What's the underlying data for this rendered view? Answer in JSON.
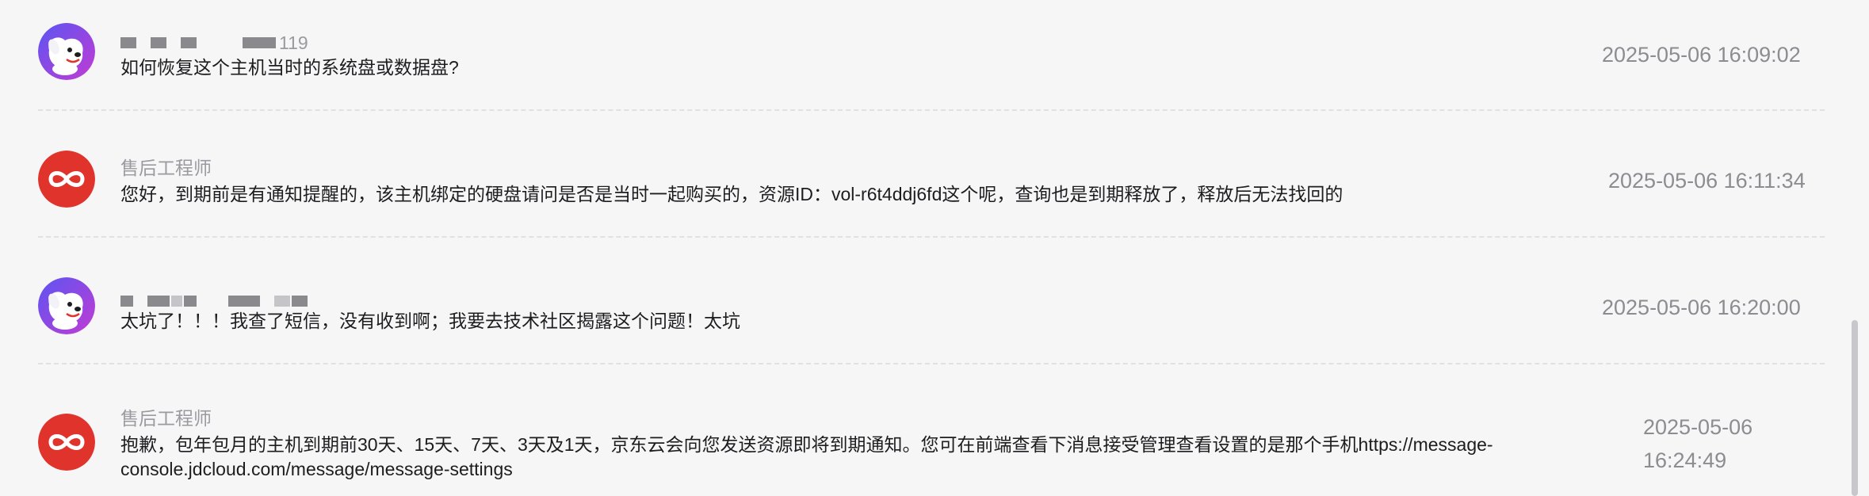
{
  "messages": [
    {
      "sender": "",
      "sender_suffix": "119",
      "text": "如何恢复这个主机当时的系统盘或数据盘?",
      "time": "2025-05-06 16:09:02"
    },
    {
      "sender": "售后工程师",
      "text": "您好，到期前是有通知提醒的，该主机绑定的硬盘请问是否是当时一起购买的，资源ID：vol-r6t4ddj6fd这个呢，查询也是到期释放了，释放后无法找回的",
      "time": "2025-05-06 16:11:34"
    },
    {
      "sender": "",
      "text": "太坑了！！！我查了短信，没有收到啊；我要去技术社区揭露这个问题！太坑",
      "time": "2025-05-06 16:20:00"
    },
    {
      "sender": "售后工程师",
      "text": "抱歉，包年包月的主机到期前30天、15天、7天、3天及1天，京东云会向您发送资源即将到期通知。您可在前端查看下消息接受管理查看设置的是那个手机https://message-console.jdcloud.com/message/message-settings",
      "time": "2025-05-06 16:24:49"
    }
  ],
  "colors": {
    "background": "#f6f6f7",
    "engineer_avatar": "#e0332c",
    "user_avatar_gradient": [
      "#6a4df0",
      "#b13fd6"
    ]
  },
  "icons": {
    "user_avatar": "jd-dog-mascot-icon",
    "engineer_avatar": "jdcloud-logo-icon"
  }
}
